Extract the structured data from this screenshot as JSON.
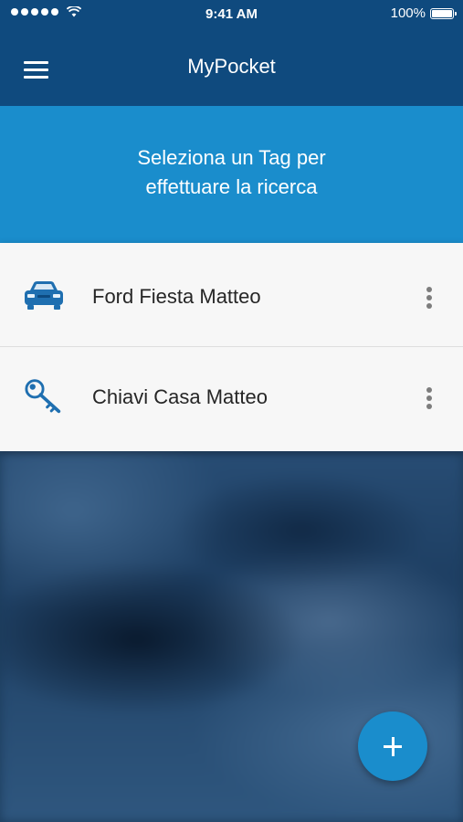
{
  "status_bar": {
    "time": "9:41 AM",
    "battery": "100%",
    "signal_icon": "signal-dots-icon",
    "wifi_icon": "wifi-icon",
    "battery_icon": "battery-icon"
  },
  "app_bar": {
    "menu_icon": "hamburger-menu-icon",
    "title": "MyPocket"
  },
  "banner": {
    "line1": "Seleziona un Tag per",
    "line2": "effettuare la ricerca"
  },
  "tags": [
    {
      "label": "Ford Fiesta Matteo",
      "icon": "car-icon",
      "more_icon": "more-vertical-icon"
    },
    {
      "label": "Chiavi Casa Matteo",
      "icon": "key-icon",
      "more_icon": "more-vertical-icon"
    }
  ],
  "fab": {
    "icon": "plus-icon"
  },
  "colors": {
    "app_bar": "#0f4a7e",
    "accent": "#1a8dcc",
    "list_background": "#f7f7f7",
    "text": "#262626"
  }
}
